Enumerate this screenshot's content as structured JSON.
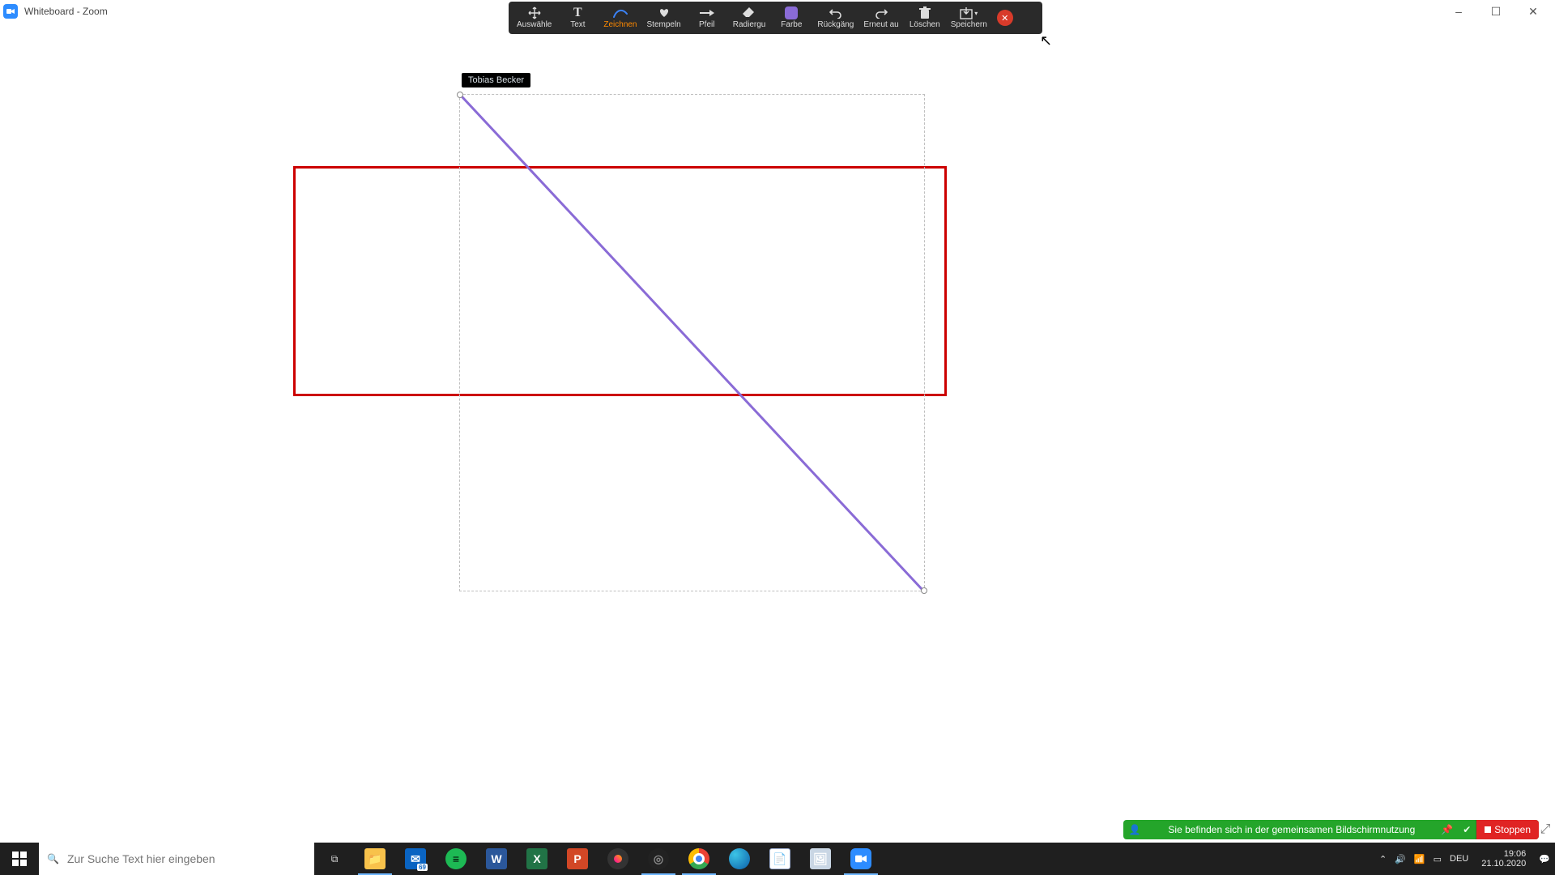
{
  "window": {
    "title": "Whiteboard - Zoom"
  },
  "toolbar": {
    "select": "Auswähle",
    "text": "Text",
    "draw": "Zeichnen",
    "stamp": "Stempeln",
    "arrow": "Pfeil",
    "erase": "Radiergu",
    "color": "Farbe",
    "undo": "Rückgäng",
    "redo": "Erneut au",
    "clear": "Löschen",
    "save": "Speichern",
    "color_value": "#8a6bd6"
  },
  "canvas": {
    "user_tag": "Tobias Becker"
  },
  "sharebar": {
    "message": "Sie befinden sich in der gemeinsamen Bildschirmnutzung",
    "stop": "Stoppen"
  },
  "taskbar": {
    "search_placeholder": "Zur Suche Text hier eingeben",
    "mail_badge": "69"
  },
  "tray": {
    "lang": "DEU",
    "time": "19:06",
    "date": "21.10.2020"
  }
}
